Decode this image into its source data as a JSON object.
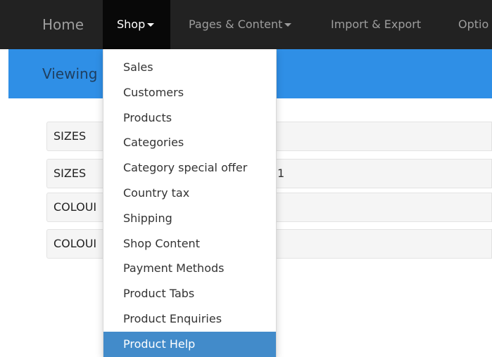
{
  "navbar": {
    "home": "Home",
    "shop": "Shop",
    "pages": "Pages & Content",
    "import": "Import & Export",
    "options": "Optio"
  },
  "subheader": {
    "title": "Viewing"
  },
  "rows": [
    {
      "label": "SIZES",
      "value": ""
    },
    {
      "label": "SIZES",
      "value": "1"
    },
    {
      "label": "COLOUI",
      "value": ""
    },
    {
      "label": "COLOUI",
      "value": ""
    }
  ],
  "shop_menu": {
    "items": [
      "Sales",
      "Customers",
      "Products",
      "Categories",
      "Category special offer",
      "Country tax",
      "Shipping",
      "Shop Content",
      "Payment Methods",
      "Product Tabs",
      "Product Enquiries",
      "Product Help"
    ],
    "active": "Product Help"
  },
  "colors": {
    "navbar_bg": "#222222",
    "nav_active_bg": "#080808",
    "header_blue": "#2f8fe6",
    "menu_active": "#428bca"
  }
}
